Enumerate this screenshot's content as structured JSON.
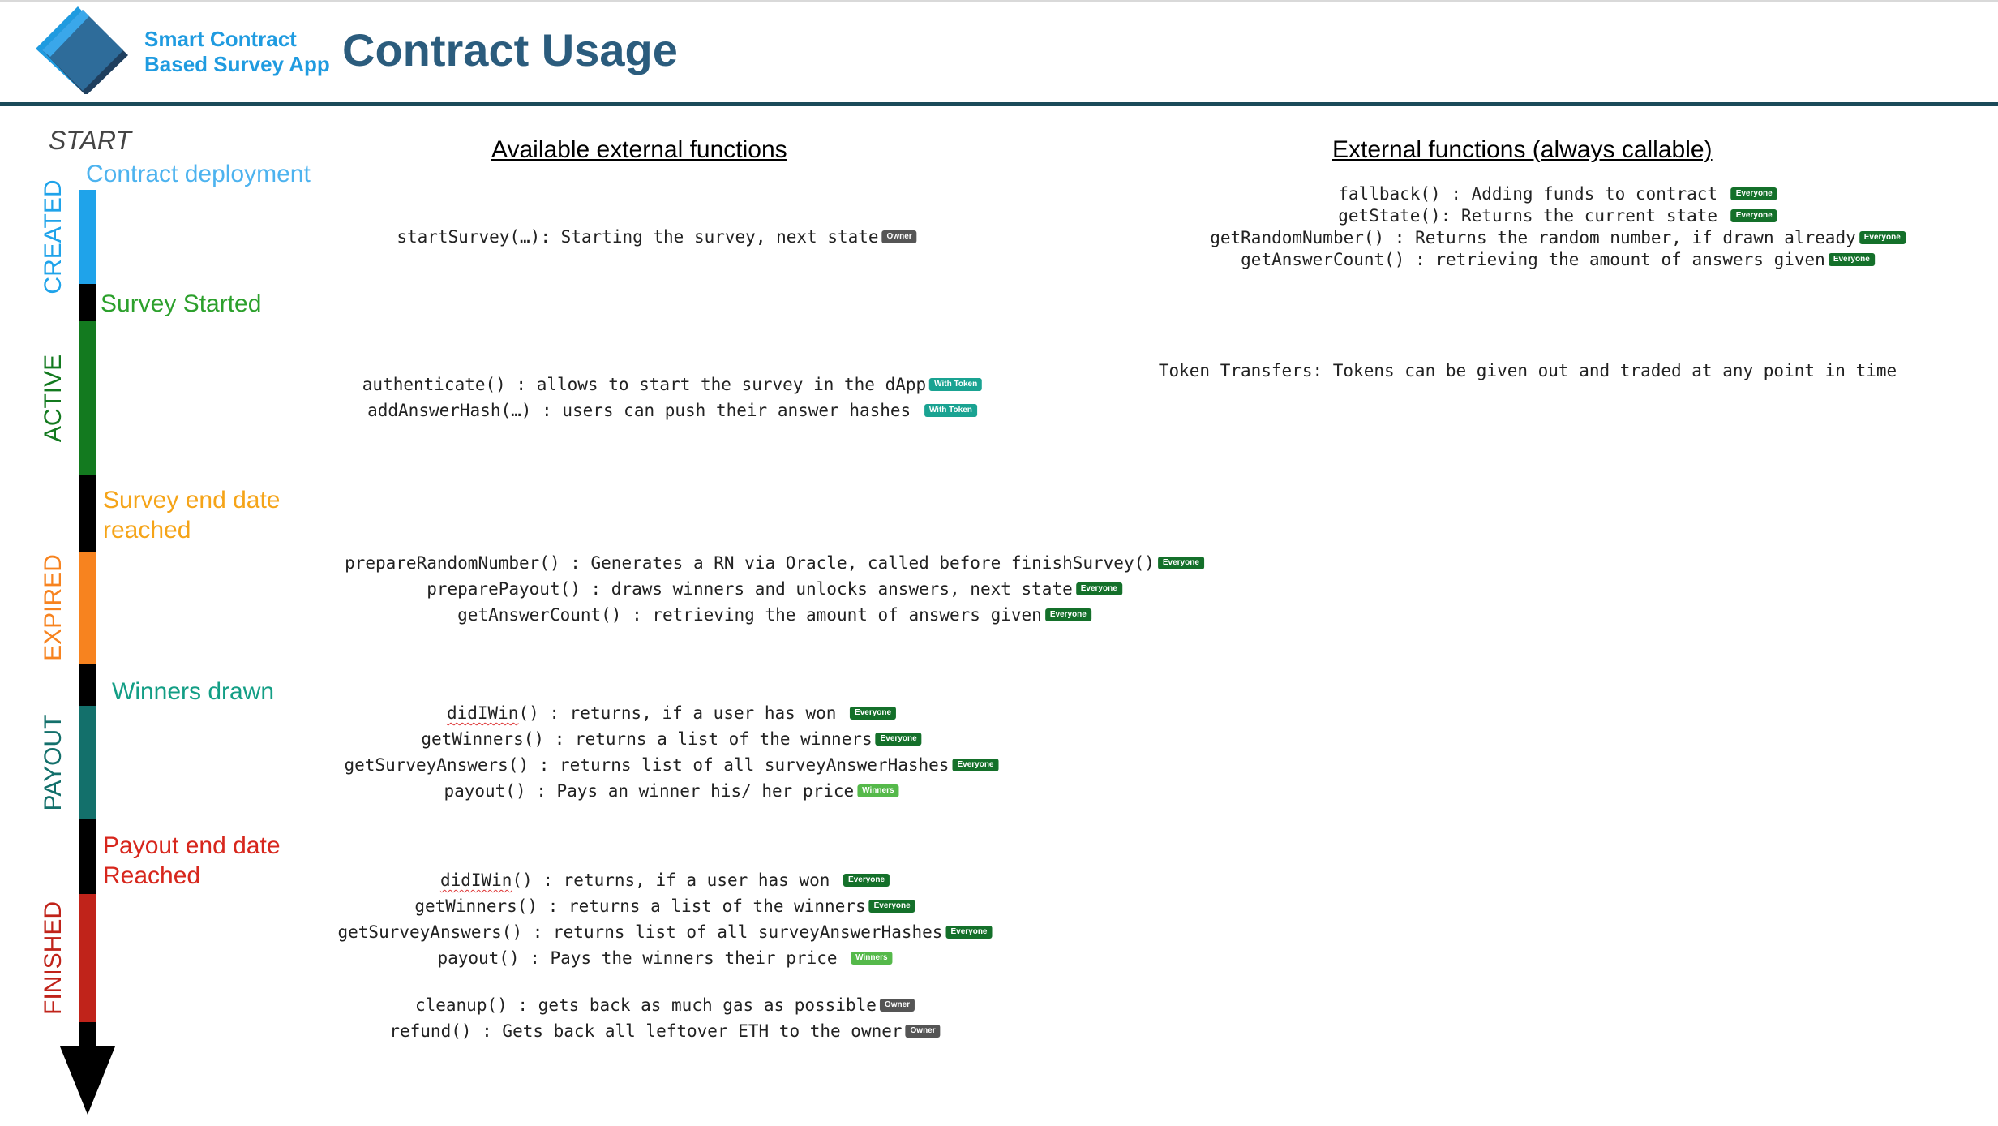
{
  "header": {
    "logo_line1": "Smart Contract",
    "logo_line2": "Based Survey App",
    "title": "Contract Usage"
  },
  "timeline": {
    "start_label": "START",
    "states": [
      {
        "id": "created",
        "label": "CREATED",
        "color": "#1fa3ea"
      },
      {
        "id": "active",
        "label": "ACTIVE",
        "color": "#137a1f"
      },
      {
        "id": "expired",
        "label": "EXPIRED",
        "color": "#f7831f"
      },
      {
        "id": "payout",
        "label": "PAYOUT",
        "color": "#13706b"
      },
      {
        "id": "finished",
        "label": "FINISHED",
        "color": "#c0231a"
      }
    ],
    "transitions": [
      {
        "id": "contract-deployment",
        "text": "Contract deployment",
        "color": "#4db3ef"
      },
      {
        "id": "survey-started",
        "text": "Survey Started",
        "color": "#2ca02c"
      },
      {
        "id": "survey-end-date",
        "line1": "Survey end date",
        "line2": "reached",
        "color": "#f5a418"
      },
      {
        "id": "winners-drawn",
        "text": "Winners drawn",
        "color": "#139e85"
      },
      {
        "id": "payout-end-date",
        "line1": "Payout end date",
        "line2": "Reached",
        "color": "#d7261c"
      }
    ],
    "black_color": "#000000"
  },
  "columns": {
    "available_heading": "Available external functions",
    "always_heading": "External functions (always callable)"
  },
  "badges": {
    "owner": "Owner",
    "everyone": "Everyone",
    "winners": "Winners",
    "token": "With Token"
  },
  "functions": {
    "created": [
      {
        "text": "startSurvey(…): Starting the survey, next state",
        "badge": "Owner"
      }
    ],
    "active": [
      {
        "text": "authenticate() : allows to start the survey in the dApp",
        "badge": "With Token"
      },
      {
        "text": "addAnswerHash(…) : users can push their answer hashes ",
        "badge": "With Token"
      }
    ],
    "expired": [
      {
        "text": "prepareRandomNumber() : Generates a RN via Oracle, called before finishSurvey()",
        "badge": "Everyone"
      },
      {
        "text": "preparePayout() : draws winners and unlocks answers, next state",
        "badge": "Everyone"
      },
      {
        "text": "getAnswerCount() : retrieving the amount of answers given",
        "badge": "Everyone"
      }
    ],
    "payout": [
      {
        "name": "didIWin",
        "text": "() : returns, if a user has won ",
        "badge": "Everyone"
      },
      {
        "text": "getWinners() : returns a list of the winners",
        "badge": "Everyone"
      },
      {
        "text": "getSurveyAnswers() : returns list of all surveyAnswerHashes",
        "badge": "Everyone"
      },
      {
        "text": "payout() : Pays an winner his/ her price",
        "badge": "Winners"
      }
    ],
    "finished": [
      {
        "name": "didIWin",
        "text": "() : returns, if a user has won ",
        "badge": "Everyone"
      },
      {
        "text": "getWinners() : returns a list of the winners",
        "badge": "Everyone"
      },
      {
        "text": "getSurveyAnswers() : returns list of all surveyAnswerHashes",
        "badge": "Everyone"
      },
      {
        "text": "payout() : Pays the winners their price ",
        "badge": "Winners"
      },
      {
        "text": "cleanup() : gets back as much gas as possible",
        "badge": "Owner"
      },
      {
        "text": "refund() : Gets back all leftover ETH to the owner",
        "badge": "Owner"
      }
    ],
    "always": [
      {
        "text": "fallback() : Adding funds to contract ",
        "badge": "Everyone"
      },
      {
        "text": "getState(): Returns the current state ",
        "badge": "Everyone"
      },
      {
        "text": "getRandomNumber() : Returns the random number, if drawn already",
        "badge": "Everyone"
      },
      {
        "text": "getAnswerCount() : retrieving the amount of answers given",
        "badge": "Everyone"
      }
    ],
    "token_note": "Token Transfers: Tokens can be given out and traded at any point in time"
  }
}
